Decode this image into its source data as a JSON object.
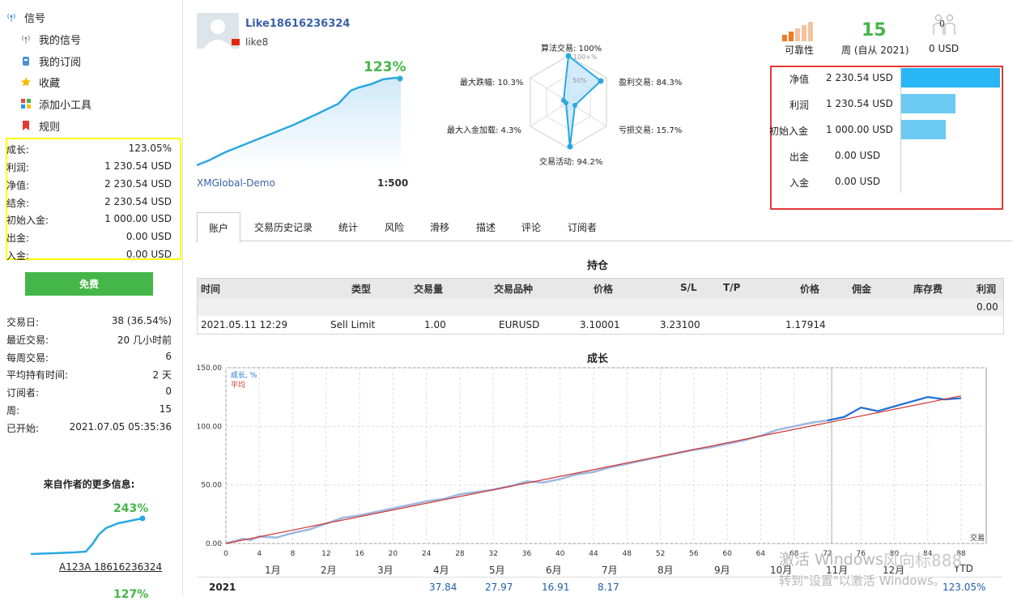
{
  "sidebar": {
    "menu": [
      {
        "label": "信号",
        "icon": "signal-icon"
      },
      {
        "label": "我的信号",
        "icon": "my-signal-icon"
      },
      {
        "label": "我的订阅",
        "icon": "subscription-icon"
      },
      {
        "label": "收藏",
        "icon": "star-icon"
      },
      {
        "label": "添加小工具",
        "icon": "widget-icon"
      },
      {
        "label": "规则",
        "icon": "bookmark-icon"
      }
    ],
    "stats": [
      {
        "k": "成长:",
        "v": "123.05%"
      },
      {
        "k": "利润:",
        "v": "1 230.54 USD"
      },
      {
        "k": "净值:",
        "v": "2 230.54 USD"
      },
      {
        "k": "结余:",
        "v": "2 230.54 USD"
      },
      {
        "k": "初始入金:",
        "v": "1 000.00 USD"
      },
      {
        "k": "出金:",
        "v": "0.00 USD"
      },
      {
        "k": "入金:",
        "v": "0.00 USD"
      }
    ],
    "free_button": "免费",
    "info": [
      {
        "k": "交易日:",
        "v": "38 (36.54%)"
      },
      {
        "k": "最近交易:",
        "v": "20 几小时前"
      },
      {
        "k": "每周交易:",
        "v": "6"
      },
      {
        "k": "平均持有时间:",
        "v": "2 天"
      },
      {
        "k": "订阅者:",
        "v": "0"
      },
      {
        "k": "周:",
        "v": "15"
      },
      {
        "k": "已开始:",
        "v": "2021.07.05 05:35:36"
      }
    ],
    "more_title": "来自作者的更多信息:",
    "more_growth": "243%",
    "more_link": "A123A 18616236324",
    "more_growth2": "127%"
  },
  "profile": {
    "name": "Like18616236324",
    "subname": "like8",
    "growth": "123%",
    "broker": "XMGlobal-Demo",
    "leverage": "1:500"
  },
  "radar": {
    "labels": {
      "top": "算法交易: 100%",
      "tr": "盈利交易: 84.3%",
      "br": "亏损交易: 15.7%",
      "bottom": "交易活动: 94.2%",
      "bl": "最大入金加载: 4.3%",
      "tl": "最大跌幅: 10.3%"
    },
    "ring100": "100+%",
    "ring50": "50%"
  },
  "top_stats": {
    "reliability_label": "可靠性",
    "weeks_value": "15",
    "weeks_label": "周 (自从 2021)",
    "subscribers_value": "0",
    "subscribers_money": "0 USD"
  },
  "balance_bars": [
    {
      "label": "净值",
      "value": "2 230.54 USD",
      "fraction": 1.0,
      "color": "#29b6f6"
    },
    {
      "label": "利润",
      "value": "1 230.54 USD",
      "fraction": 0.552,
      "color": "#6ccaf2"
    },
    {
      "label": "初始入金",
      "value": "1 000.00 USD",
      "fraction": 0.448,
      "color": "#6ccaf2"
    },
    {
      "label": "出金",
      "value": "0.00 USD",
      "fraction": 0.0,
      "color": "#6ccaf2"
    },
    {
      "label": "入金",
      "value": "0.00 USD",
      "fraction": 0.0,
      "color": "#6ccaf2"
    }
  ],
  "tabs": [
    "账户",
    "交易历史记录",
    "统计",
    "风险",
    "滑移",
    "描述",
    "评论",
    "订阅者"
  ],
  "positions": {
    "title": "持仓",
    "headers": [
      "时间",
      "类型",
      "交易量",
      "交易品种",
      "价格",
      "S/L",
      "T/P",
      "价格",
      "佣金",
      "库存费",
      "利润"
    ],
    "summary_profit": "0.00",
    "row": [
      "2021.05.11 12:29",
      "Sell Limit",
      "1.00",
      "EURUSD",
      "3.10001",
      "3.23100",
      "",
      "1.17914",
      "",
      "",
      ""
    ]
  },
  "growth_chart": {
    "title": "成长",
    "legend1": "成长, %",
    "legend2": "平均",
    "xlabel": "交易",
    "months": [
      "1月",
      "2月",
      "3月",
      "4月",
      "5月",
      "6月",
      "7月",
      "8月",
      "9月",
      "10月",
      "11月",
      "12月",
      "YTD"
    ],
    "year_row": {
      "year": "2021",
      "values": [
        "",
        "",
        "",
        "37.84",
        "27.97",
        "16.91",
        "8.17",
        "",
        "",
        "",
        "",
        "",
        "123.05%"
      ]
    }
  },
  "chart_data": {
    "type": "line",
    "title": "成长",
    "xlabel": "交易",
    "ylabel": "",
    "x_ticks": [
      0,
      4,
      8,
      12,
      16,
      20,
      24,
      28,
      32,
      36,
      40,
      44,
      48,
      52,
      56,
      60,
      64,
      68,
      72,
      76,
      80,
      84,
      88
    ],
    "y_ticks": [
      "0.00",
      "50.00",
      "100.00",
      "150.00"
    ],
    "ylim": [
      0,
      150
    ],
    "xlim": [
      0,
      91
    ],
    "series": [
      {
        "name": "成长, %",
        "x": [
          0,
          2,
          3,
          4,
          6,
          8,
          10,
          12,
          14,
          16,
          18,
          20,
          22,
          24,
          26,
          28,
          30,
          32,
          34,
          36,
          38,
          40,
          42,
          44,
          46,
          48,
          50,
          52,
          54,
          56,
          58,
          60,
          62,
          64,
          66,
          68,
          70,
          72,
          74,
          76,
          78,
          80,
          82,
          84,
          86,
          88
        ],
        "values": [
          0,
          4,
          3,
          6,
          5,
          9,
          12,
          17,
          22,
          24,
          27,
          30,
          33,
          36,
          38,
          42,
          44,
          46,
          49,
          53,
          52,
          55,
          59,
          61,
          65,
          68,
          71,
          74,
          77,
          80,
          82,
          85,
          88,
          92,
          97,
          100,
          103,
          105,
          108,
          116,
          113,
          117,
          121,
          125,
          123,
          124
        ]
      },
      {
        "name": "平均",
        "x": [
          0,
          88
        ],
        "values": [
          0,
          126
        ]
      }
    ]
  },
  "watermark": {
    "line1": "激活 Windows",
    "line2": "转到\"设置\"以激活 Windows。",
    "brand": "风向标888"
  }
}
